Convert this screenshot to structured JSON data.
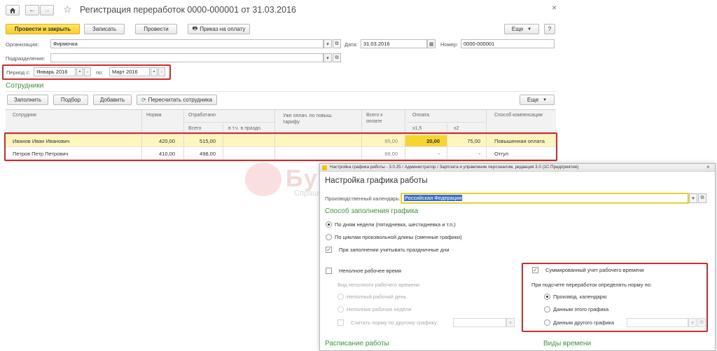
{
  "main": {
    "title": "Регистрация переработок 0000-000001 от 31.03.2016",
    "close_glyph": "×",
    "toolbar": {
      "post_close": "Провести и закрыть",
      "save": "Записать",
      "post": "Провести",
      "order": "Приказ на оплату",
      "more": "Еще",
      "help": "?"
    },
    "org_label": "Организация:",
    "org_value": "Фирмочка",
    "date_label": "Дата:",
    "date_value": "31.03.2016",
    "number_label": "Номер:",
    "number_value": "0000-000001",
    "dept_label": "Подразделение:",
    "dept_value": "",
    "period_label": "Период с:",
    "period_from": "Январь 2016",
    "period_to_label": "по:",
    "period_to": "Март 2016",
    "employees_title": "Сотрудники",
    "table_toolbar": {
      "fill": "Заполнить",
      "select": "Подбор",
      "add": "Добавить",
      "recalc": "Пересчитать сотрудника",
      "more": "Еще"
    },
    "columns": {
      "employee": "Сотрудник",
      "norm": "Норма",
      "worked": "Отработано",
      "total": "Всего",
      "holidays": "в т.ч. в праздн.",
      "paid_increased": "Уже оплач. по повыш. тарифу",
      "total_to_pay_1": "Всего к",
      "total_to_pay_2": "оплате",
      "payment": "Оплата",
      "x15": "x1,5",
      "x2": "x2",
      "compensation": "Способ компенсации"
    },
    "rows": [
      {
        "employee": "Иванов Иван Иванович",
        "norm": "420,00",
        "total": "515,00",
        "to_pay": "95,00",
        "x15": "20,00",
        "x2": "75,00",
        "compensation": "Повышенная оплата"
      },
      {
        "employee": "Петров Петр Петрович",
        "norm": "410,00",
        "total": "498,00",
        "to_pay": "88,00",
        "x15": "-",
        "x2": "-",
        "compensation": "Отгул"
      }
    ]
  },
  "dialog": {
    "window_title": "Настройка графика работы - 3.0.25 / Администратор / Зарплата и управление персоналом, редакция 3.0 (1С:Предприятие)",
    "heading": "Настройка графика работы",
    "calendar_label": "Производственный календарь:",
    "calendar_value": "Российская Федерация",
    "fill_method_title": "Способ заполнения графика",
    "by_weekdays": "По дням недели (пятидневка, шестидневка и т.п.)",
    "by_cycles": "По циклам произвольной длины (сменные графики)",
    "consider_holidays": "При заполнении учитывать праздничные дни",
    "part_time": "Неполное рабочее время",
    "part_time_type": "Вид неполного рабочего времени",
    "part_day": "Неполный рабочий день",
    "part_week": "Неполная рабочая неделя",
    "norm_by_other": "Считать норму по другому графику:",
    "summarized": "Суммированный учет рабочего времени",
    "norm_question": "При подсчете переработок определять норму по:",
    "by_prod_calendar": "Производ. календарю",
    "by_this_schedule": "Данным этого графика",
    "by_other_schedule": "Данным другого графика",
    "schedule_title": "Расписание работы",
    "time_types_title": "Виды времени"
  },
  "watermark": {
    "line1": "БухЭксперт8",
    "line2": "Спрашивайте профессионалов 1С"
  },
  "colors": {
    "accent_green": "#3a9a3a",
    "highlight_red": "#d62a2a",
    "primary_yellow": "#f7cf2a",
    "selected_row": "#fff6bf"
  }
}
